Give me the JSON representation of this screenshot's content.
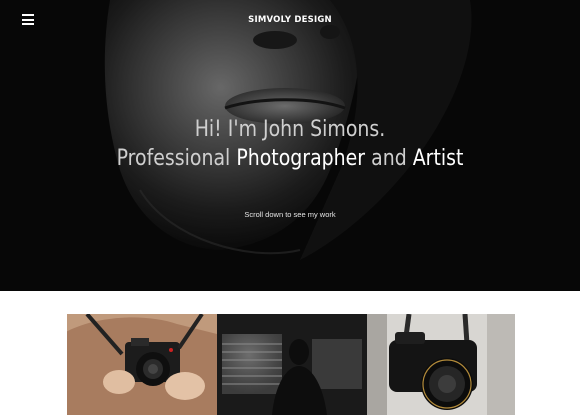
{
  "header": {
    "brand": "SIMVOLY DESIGN",
    "menu_icon": "hamburger-menu-icon"
  },
  "hero": {
    "line1": "Hi! I'm John Simons.",
    "line2_part1": "Professional ",
    "line2_highlight1": "Photographer",
    "line2_part2": " and ",
    "line2_highlight2": "Artist",
    "subtitle": "Scroll down to see my work"
  },
  "gallery": {
    "tiles": [
      {
        "name": "woman-holding-camera-photo"
      },
      {
        "name": "silhouette-at-window-photo"
      },
      {
        "name": "dslr-camera-on-strap-photo"
      }
    ]
  }
}
